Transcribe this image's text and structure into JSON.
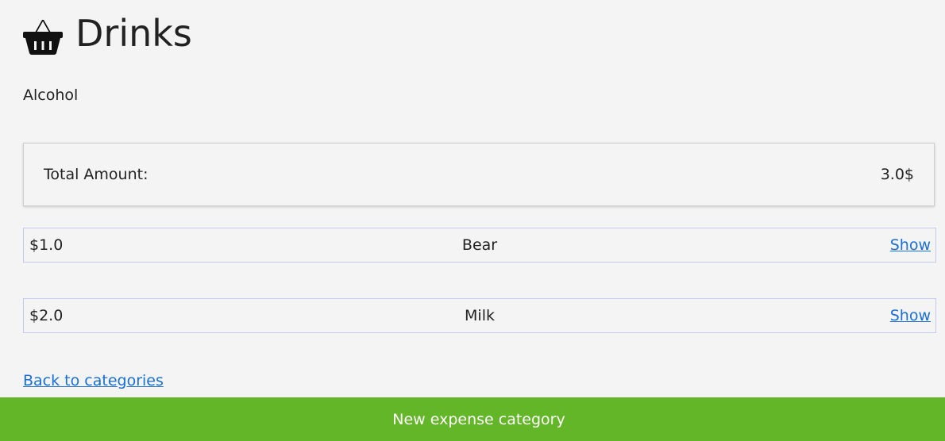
{
  "category": {
    "icon": "basket-icon",
    "title": "Drinks",
    "description": "Alcohol"
  },
  "total": {
    "label": "Total Amount:",
    "value": "3.0$"
  },
  "expenses": [
    {
      "amount": "$1.0",
      "name": "Bear",
      "action": "Show"
    },
    {
      "amount": "$2.0",
      "name": "Milk",
      "action": "Show"
    }
  ],
  "navigation": {
    "back_label": "Back to categories"
  },
  "footer": {
    "new_category_label": "New expense category",
    "color": "#63b628"
  },
  "colors": {
    "background": "#f4f4f4",
    "link": "#1a6fd6",
    "row_border": "#c8c8ee"
  }
}
